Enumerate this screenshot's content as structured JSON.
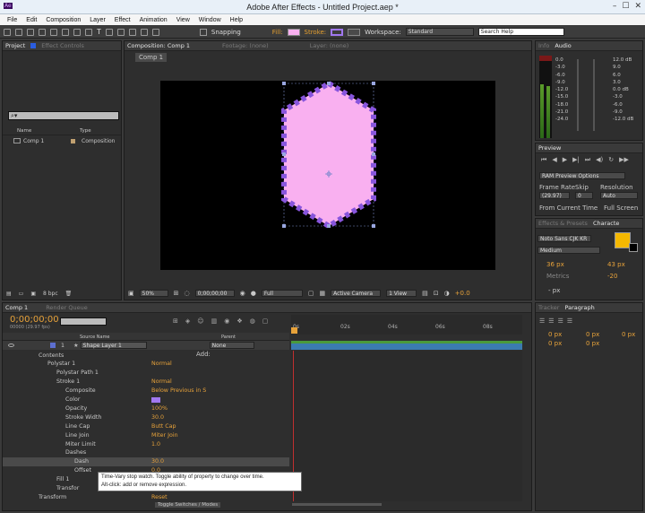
{
  "title_bar": {
    "app_icon": "Ae",
    "title": "Adobe After Effects - Untitled Project.aep *",
    "min": "–",
    "max": "☐",
    "close": "✕"
  },
  "menu": [
    "File",
    "Edit",
    "Composition",
    "Layer",
    "Effect",
    "Animation",
    "View",
    "Window",
    "Help"
  ],
  "toolbar": {
    "snapping": "Snapping",
    "fill": "Fill:",
    "stroke": "Stroke:",
    "workspace_label": "Workspace:",
    "workspace_value": "Standard",
    "search_placeholder": "Search Help",
    "fill_color": "#f9b0f0",
    "stroke_color": "#a178f0"
  },
  "project_panel": {
    "tabs": [
      "Project",
      "Effect Controls"
    ],
    "search": "",
    "col_name": "Name",
    "col_type": "Type",
    "items": [
      {
        "name": "Comp 1",
        "type": "Composition"
      }
    ],
    "bpc": "8 bpc"
  },
  "comp_panel": {
    "tabs": [
      "Composition: Comp 1",
      "Footage: (none)",
      "Layer: (none)"
    ],
    "crumb": "Comp 1",
    "zoom": "50%",
    "timecode": "0;00;00;00",
    "resolution": "Full",
    "camera": "Active Camera",
    "views": "1 View",
    "exposure": "+0.0",
    "shape_fill": "#f9b0f0",
    "shape_stroke": "#8855dd"
  },
  "info_panel": {
    "tabs": [
      "Info",
      "Audio"
    ],
    "db_left": [
      "0.0",
      "-3.0",
      "-6.0",
      "-9.0",
      "-12.0",
      "-15.0",
      "-18.0",
      "-21.0",
      "-24.0"
    ],
    "db_right": [
      "12.0 dB",
      "9.0",
      "6.0",
      "3.0",
      "0.0 dB",
      "-3.0",
      "-6.0",
      "-9.0",
      "-12.0 dB"
    ]
  },
  "preview_panel": {
    "title": "Preview",
    "ram": "RAM Preview Options",
    "frame_rate_label": "Frame Rate",
    "skip_label": "Skip",
    "resolution_label": "Resolution",
    "frame_rate": "(29.97)",
    "skip": "0",
    "resolution": "Auto",
    "from_current": "From Current Time",
    "full_screen": "Full Screen"
  },
  "character_panel": {
    "tabs": [
      "Effects & Presets",
      "Characte"
    ],
    "font": "Noto Sans CJK KR",
    "style": "Medium",
    "size": "36 px",
    "leading": "43 px",
    "kerning": "Metrics",
    "tracking": "-20",
    "indent": "- px",
    "color": "#f5b800"
  },
  "paragraph_panel": {
    "tabs": [
      "Tracker",
      "Paragraph"
    ],
    "v": [
      "0 px",
      "0 px",
      "0 px",
      "0 px",
      "0 px"
    ]
  },
  "timeline": {
    "tabs": [
      "Comp 1",
      "Render Queue"
    ],
    "timecode": "0;00;00;00",
    "fps": "00000 (29.97 fps)",
    "col_source": "Source Name",
    "col_parent": "Parent",
    "ticks": [
      "0s",
      "02s",
      "04s",
      "06s",
      "08s"
    ],
    "add": "Add:",
    "toggle": "Toggle Switches / Modes",
    "layer": {
      "num": "1",
      "name": "Shape Layer 1",
      "parent": "None"
    },
    "props": [
      {
        "label": "Contents",
        "value": "",
        "lvl": 1
      },
      {
        "label": "Polystar 1",
        "value": "Normal",
        "lvl": 2
      },
      {
        "label": "Polystar Path 1",
        "value": "",
        "lvl": 3
      },
      {
        "label": "Stroke 1",
        "value": "Normal",
        "lvl": 3
      },
      {
        "label": "Composite",
        "value": "Below Previous in S",
        "lvl": 4
      },
      {
        "label": "Color",
        "value": "",
        "lvl": 4
      },
      {
        "label": "Opacity",
        "value": "100%",
        "lvl": 4
      },
      {
        "label": "Stroke Width",
        "value": "30.0",
        "lvl": 4
      },
      {
        "label": "Line Cap",
        "value": "Butt Cap",
        "lvl": 4
      },
      {
        "label": "Line Join",
        "value": "Miter Join",
        "lvl": 4
      },
      {
        "label": "Miter Limit",
        "value": "1.0",
        "lvl": 4
      },
      {
        "label": "Dashes",
        "value": "",
        "lvl": 4
      },
      {
        "label": "Dash",
        "value": "30.0",
        "lvl": 5
      },
      {
        "label": "Offset",
        "value": "0.0",
        "lvl": 5
      },
      {
        "label": "Fill 1",
        "value": "",
        "lvl": 3
      },
      {
        "label": "Transfor",
        "value": "",
        "lvl": 3
      },
      {
        "label": "Transform",
        "value": "Reset",
        "lvl": 1
      }
    ],
    "tooltip": [
      "Time-Vary stop watch. Toggle ability of property to change over time.",
      "Alt-click: add or remove expression."
    ]
  }
}
